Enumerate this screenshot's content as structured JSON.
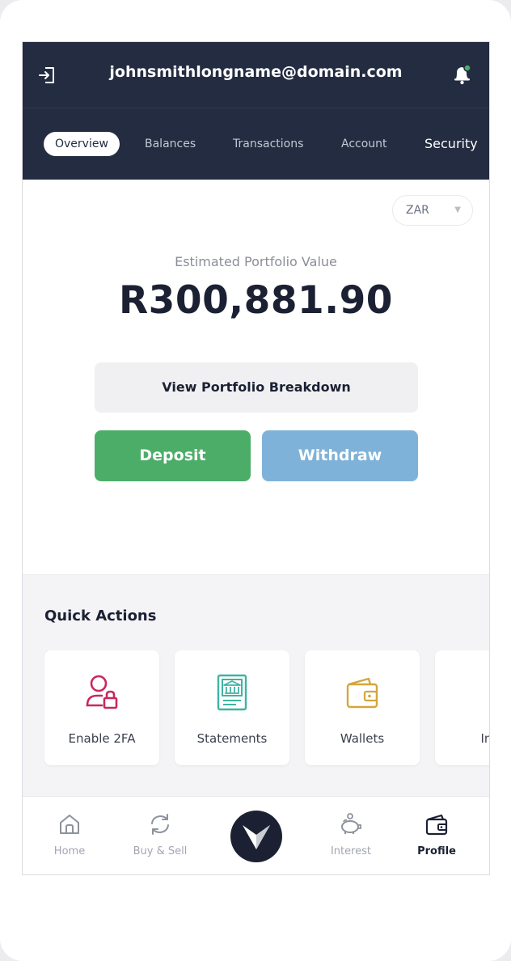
{
  "header": {
    "email": "johnsmithlongname@domain.com",
    "logout_icon": "logout-icon",
    "notification_icon": "bell-icon",
    "notification_dot_color": "#4cad69",
    "bg_color": "#232c40"
  },
  "tabs": [
    {
      "label": "Overview",
      "active": true
    },
    {
      "label": "Balances",
      "active": false
    },
    {
      "label": "Transactions",
      "active": false
    },
    {
      "label": "Account",
      "active": false
    },
    {
      "label": "Security",
      "active": false
    }
  ],
  "currency": {
    "selected": "ZAR"
  },
  "portfolio": {
    "label": "Estimated Portfolio Value",
    "value": "R300,881.90",
    "breakdown_label": "View Portfolio Breakdown"
  },
  "actions": {
    "deposit_label": "Deposit",
    "deposit_color": "#4cad69",
    "withdraw_label": "Withdraw",
    "withdraw_color": "#7fb2d8"
  },
  "quick_actions": {
    "title": "Quick Actions",
    "items": [
      {
        "label": "Enable 2FA",
        "icon": "user-lock-icon",
        "color": "#c8285e"
      },
      {
        "label": "Statements",
        "icon": "bank-statement-icon",
        "color": "#3fb3a3"
      },
      {
        "label": "Wallets",
        "icon": "wallet-icon",
        "color": "#d4a63d"
      },
      {
        "label": "Inte",
        "icon": "piggy-bank-icon",
        "color": "#4cad69"
      }
    ]
  },
  "bottom_nav": {
    "items": [
      {
        "label": "Home",
        "icon": "home-icon",
        "active": false
      },
      {
        "label": "Buy & Sell",
        "icon": "refresh-icon",
        "active": false
      },
      {
        "label": "Interest",
        "icon": "piggy-bank-icon",
        "active": false
      },
      {
        "label": "Profile",
        "icon": "wallet-icon",
        "active": true
      }
    ],
    "center_icon": "brand-logo-icon"
  }
}
